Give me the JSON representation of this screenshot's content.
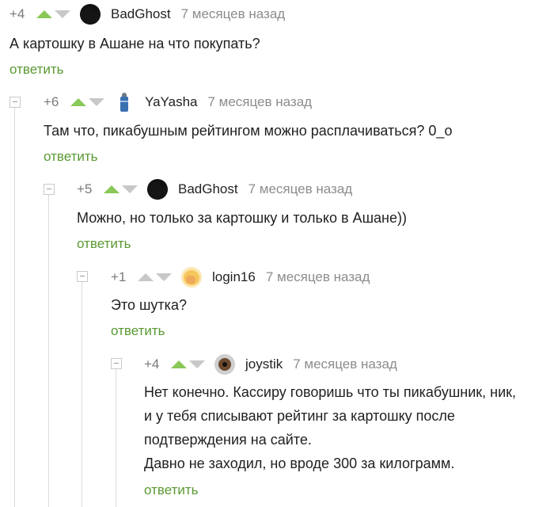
{
  "comments": [
    {
      "rating": "+4",
      "username": "BadGhost",
      "time": "7 месяцев назад",
      "text": [
        "А картошку в Ашане на что покупать?"
      ],
      "reply_label": "ответить"
    },
    {
      "rating": "+6",
      "username": "YaYasha",
      "time": "7 месяцев назад",
      "text": [
        "Там что, пикабушным рейтингом можно расплачиваться? 0_о"
      ],
      "reply_label": "ответить"
    },
    {
      "rating": "+5",
      "username": "BadGhost",
      "time": "7 месяцев назад",
      "text": [
        "Можно, но только за картошку и только в Ашане))"
      ],
      "reply_label": "ответить"
    },
    {
      "rating": "+1",
      "username": "login16",
      "time": "7 месяцев назад",
      "text": [
        "Это шутка?"
      ],
      "reply_label": "ответить"
    },
    {
      "rating": "+4",
      "username": "joystik",
      "time": "7 месяцев назад",
      "text": [
        "Нет конечно. Кассиру говоришь что ты пикабушник, ник,",
        "и у тебя списывают рейтинг за картошку после",
        "подтверждения на сайте.",
        "Давно не заходил, но вроде 300 за килограмм."
      ],
      "reply_label": "ответить"
    }
  ],
  "colors": {
    "vote_up_active": "#8ac858",
    "vote_inactive": "#c8c8c8",
    "reply_link": "#5a9932",
    "time_text": "#8c8c8c"
  }
}
